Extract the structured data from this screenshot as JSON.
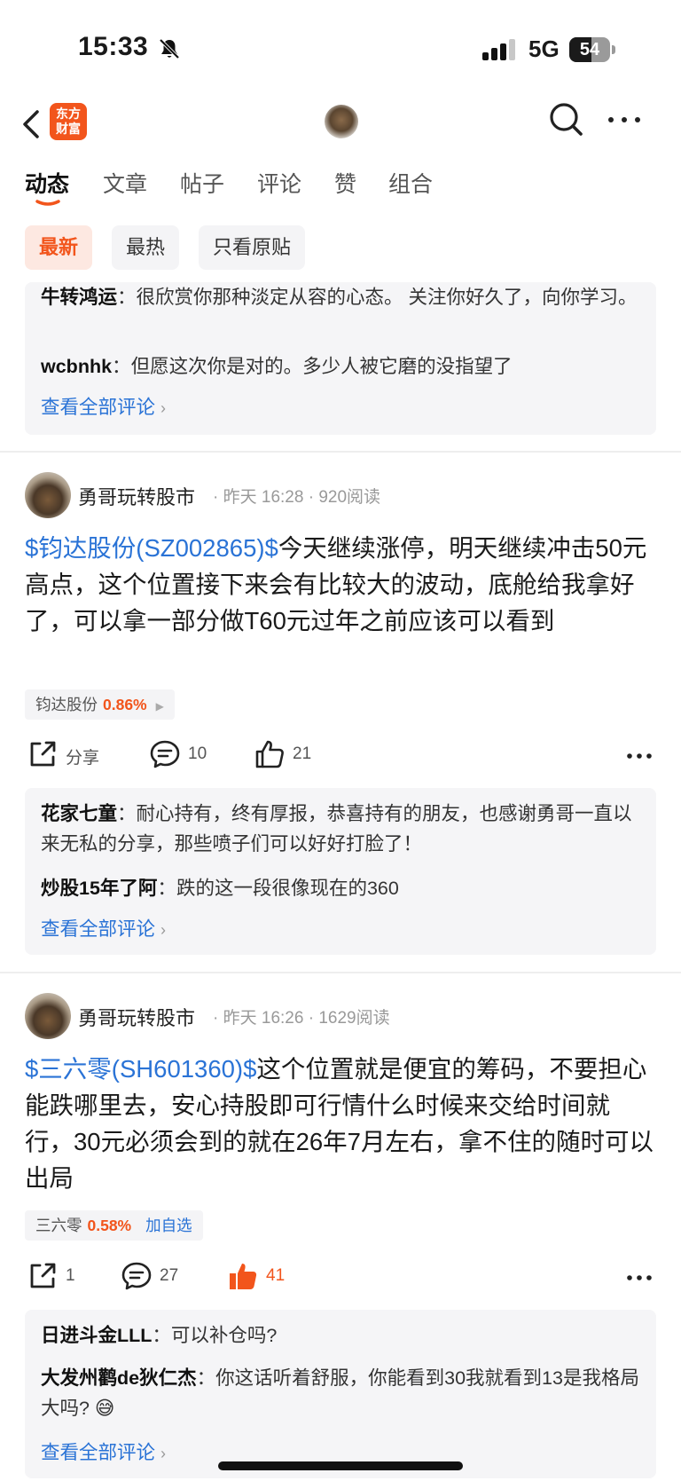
{
  "status_bar": {
    "time": "15:33",
    "network": "5G",
    "battery_level": "54",
    "battery_fraction": 0.54
  },
  "header": {
    "app_logo_line1": "东方",
    "app_logo_line2": "财富"
  },
  "tabs": [
    {
      "label": "动态",
      "active": true
    },
    {
      "label": "文章"
    },
    {
      "label": "帖子"
    },
    {
      "label": "评论"
    },
    {
      "label": "赞"
    },
    {
      "label": "组合"
    }
  ],
  "filters": [
    {
      "label": "最新",
      "active": true
    },
    {
      "label": "最热"
    },
    {
      "label": "只看原贴"
    }
  ],
  "view_all_label": "查看全部评论",
  "top_comments": {
    "items": [
      {
        "author": "牛转鸿运",
        "text": "很欣赏你那种淡定从容的心态。 关注你好久了，向你学习。"
      },
      {
        "author": "wcbnhk",
        "text": "但愿这次你是对的。多少人被它磨的没指望了"
      }
    ]
  },
  "posts": [
    {
      "author": "勇哥玩转股市",
      "time": "昨天 16:28",
      "reads": "920阅读",
      "stock_link": "$钧达股份(SZ002865)$",
      "content": "今天继续涨停，明天继续冲击50元高点，这个位置接下来会有比较大的波动，底舱给我拿好了，可以拿一部分做T60元过年之前应该可以看到",
      "stock_name": "钧达股份",
      "stock_change": "0.86%",
      "share_label": "分享",
      "comment_count": "10",
      "like_count": "21",
      "comments": [
        {
          "author": "花家七童",
          "text": "耐心持有，终有厚报，恭喜持有的朋友，也感谢勇哥一直以来无私的分享，那些喷子们可以好好打脸了！"
        },
        {
          "author": "炒股15年了阿",
          "text": "跌的这一段很像现在的360"
        }
      ]
    },
    {
      "author": "勇哥玩转股市",
      "time": "昨天 16:26",
      "reads": "1629阅读",
      "stock_link": "$三六零(SH601360)$",
      "content": "这个位置就是便宜的筹码，不要担心能跌哪里去，安心持股即可行情什么时候来交给时间就行，30元必须会到的就在26年7月左右，拿不住的随时可以出局",
      "stock_name": "三六零",
      "stock_change": "0.58%",
      "watch_label": "加自选",
      "share_count": "1",
      "comment_count": "27",
      "like_count": "41",
      "comments": [
        {
          "author": "日进斗金LLL",
          "text": "可以补仓吗?"
        },
        {
          "author": "大发州鹳de狄仁杰",
          "text": "你这话听着舒服，你能看到30我就看到13是我格局大吗?",
          "emoji": "😅"
        }
      ]
    }
  ],
  "colors": {
    "accent": "#f2551c",
    "link": "#2a73d6",
    "comment_bg": "#f5f5f7"
  }
}
